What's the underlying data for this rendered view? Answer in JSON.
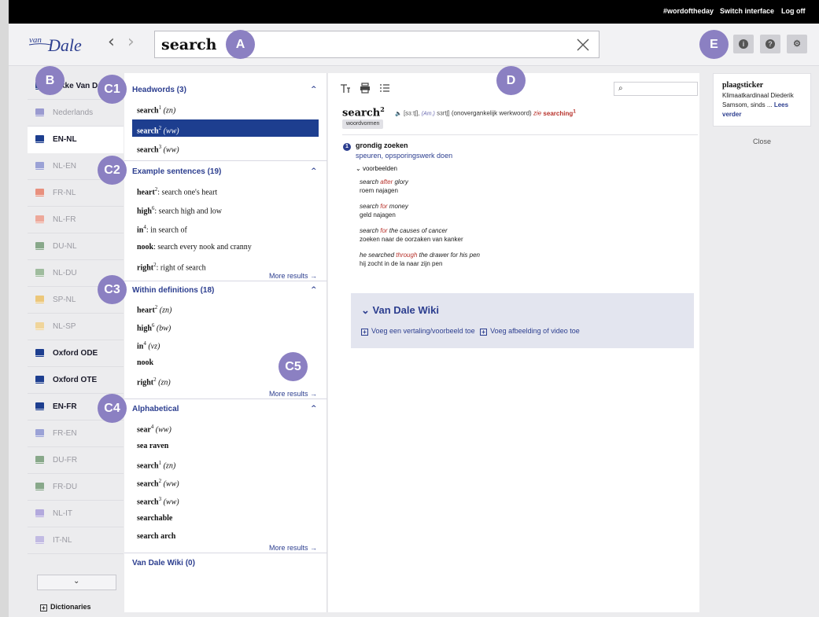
{
  "topbar": {
    "wordoftheday": "#wordoftheday",
    "switch_interface": "Switch interface",
    "logoff": "Log off"
  },
  "header": {
    "logo_text_top": "van",
    "logo_text_main": "Dale",
    "back_arrow": "‹",
    "forward_arrow": "›",
    "search_value": "search",
    "info_glyph": "i",
    "help_glyph": "?",
    "settings_glyph": "⚙"
  },
  "markers": {
    "A": "A",
    "B": "B",
    "C1": "C1",
    "C2": "C2",
    "C3": "C3",
    "C4": "C4",
    "C5": "C5",
    "D": "D",
    "E": "E"
  },
  "sidebar": {
    "items": [
      {
        "label": "Dikke Van Dale",
        "color": "#2f4a8c",
        "bold": true
      },
      {
        "label": "Nederlands",
        "color": "#9a9ad0",
        "bold": false
      },
      {
        "label": "EN-NL",
        "color": "#1d3e8f",
        "bold": true,
        "active": true
      },
      {
        "label": "NL-EN",
        "color": "#9ba2d6",
        "bold": false
      },
      {
        "label": "FR-NL",
        "color": "#e8907e",
        "bold": false
      },
      {
        "label": "NL-FR",
        "color": "#eda89a",
        "bold": false
      },
      {
        "label": "DU-NL",
        "color": "#88a88a",
        "bold": false
      },
      {
        "label": "NL-DU",
        "color": "#9fbc9e",
        "bold": false
      },
      {
        "label": "SP-NL",
        "color": "#ecc77a",
        "bold": false
      },
      {
        "label": "NL-SP",
        "color": "#f0d59b",
        "bold": false
      },
      {
        "label": "Oxford ODE",
        "color": "#1d3e8f",
        "bold": true
      },
      {
        "label": "Oxford OTE",
        "color": "#1d3e8f",
        "bold": true
      },
      {
        "label": "EN-FR",
        "color": "#1d3e8f",
        "bold": true
      },
      {
        "label": "FR-EN",
        "color": "#9ba2d6",
        "bold": false
      },
      {
        "label": "DU-FR",
        "color": "#88a88a",
        "bold": false
      },
      {
        "label": "FR-DU",
        "color": "#88a88a",
        "bold": false
      },
      {
        "label": "NL-IT",
        "color": "#b3a9dd",
        "bold": false
      },
      {
        "label": "IT-NL",
        "color": "#c2bbe3",
        "bold": false
      }
    ],
    "scroll_glyph": "⌄",
    "dictionaries_label": "Dictionaries",
    "plus_glyph": "+"
  },
  "results": {
    "headwords": {
      "title": "Headwords (3)",
      "items": [
        {
          "word": "search",
          "sup": "1",
          "pos": "(zn)"
        },
        {
          "word": "search",
          "sup": "2",
          "pos": "(ww)"
        },
        {
          "word": "search",
          "sup": "3",
          "pos": "(ww)"
        }
      ]
    },
    "examples": {
      "title": "Example sentences (19)",
      "items": [
        {
          "word": "heart",
          "sup": "2",
          "text": ": search one's heart"
        },
        {
          "word": "high",
          "sup": "6",
          "text": ": search high and low"
        },
        {
          "word": "in",
          "sup": "4",
          "text": ": in search of"
        },
        {
          "word": "nook",
          "sup": "",
          "text": ": search every nook and cranny"
        },
        {
          "word": "right",
          "sup": "2",
          "text": ": right of search"
        }
      ],
      "more": "More results →"
    },
    "within": {
      "title": "Within definitions (18)",
      "items": [
        {
          "word": "heart",
          "sup": "2",
          "pos": "(zn)"
        },
        {
          "word": "high",
          "sup": "6",
          "pos": "(bw)"
        },
        {
          "word": "in",
          "sup": "4",
          "pos": "(vz)"
        },
        {
          "word": "nook",
          "sup": "",
          "pos": ""
        },
        {
          "word": "right",
          "sup": "2",
          "pos": "(zn)"
        }
      ],
      "more": "More results →"
    },
    "alphabetical": {
      "title": "Alphabetical",
      "items": [
        {
          "word": "sear",
          "sup": "4",
          "pos": "(ww)"
        },
        {
          "word": "sea raven",
          "sup": "",
          "pos": ""
        },
        {
          "word": "search",
          "sup": "1",
          "pos": "(zn)"
        },
        {
          "word": "search",
          "sup": "2",
          "pos": "(ww)"
        },
        {
          "word": "search",
          "sup": "3",
          "pos": "(ww)"
        },
        {
          "word": "searchable",
          "sup": "",
          "pos": ""
        },
        {
          "word": "search arch",
          "sup": "",
          "pos": ""
        }
      ],
      "more": "More results →"
    },
    "wiki": {
      "title": "Van Dale Wiki (0)"
    },
    "chevron_glyph": "^"
  },
  "detail": {
    "headword": "search",
    "headword_sup": "2",
    "speaker_glyph": "🔈",
    "pron": "[sɜːtʃ],",
    "am": "(Am.)",
    "pron_am": "sɜrtʃ]",
    "grammar": "(onovergankelijk werkwoord)",
    "zie_label": "zie",
    "zie_target": "searching",
    "zie_sup": "1",
    "tag": "woordvormen",
    "sense_num": "1",
    "sense": "grondig zoeken",
    "synonyms": "speuren, opsporingswerk doen",
    "examples_label": "voorbeelden",
    "examples_chevron": "⌄",
    "examples": [
      {
        "pre": "search ",
        "kw": "after",
        "post": " glory",
        "trans": "roem najagen"
      },
      {
        "pre": "search ",
        "kw": "for",
        "post": " money",
        "trans": "geld najagen"
      },
      {
        "pre": "search ",
        "kw": "for",
        "post": " the causes of cancer",
        "trans": "zoeken naar de oorzaken van kanker"
      },
      {
        "pre": "he searched ",
        "kw": "through",
        "post": " the drawer for his pen",
        "trans": "hij zocht in de la naar zijn pen"
      }
    ],
    "search_glyph": "⌕",
    "search_placeholder": "",
    "wiki": {
      "title": "Van Dale Wiki",
      "chevron": "⌄",
      "add_translation": "Voeg een vertaling/voorbeeld toe",
      "add_image": "Voeg afbeelding of video toe"
    }
  },
  "wotd": {
    "title": "plaagsticker",
    "desc": "Klimaatkardinaal Diederik Samsom, sinds ...",
    "more": "Lees verder",
    "close": "Close"
  },
  "colors": {
    "accent": "#2c3e8f",
    "selected": "#1d3e8f",
    "marker": "#8b80c2",
    "keyword": "#b8322b"
  }
}
